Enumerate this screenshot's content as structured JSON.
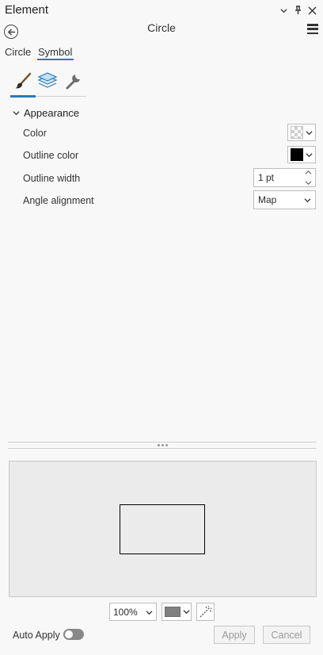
{
  "pane": {
    "title": "Element",
    "controls": [
      "options-dropdown",
      "pin-icon",
      "close-icon"
    ]
  },
  "header": {
    "title": "Circle"
  },
  "tabs": [
    {
      "label": "Circle",
      "active": false
    },
    {
      "label": "Symbol",
      "active": true
    }
  ],
  "icon_tabs": [
    {
      "icon": "paintbrush-icon",
      "active": true
    },
    {
      "icon": "layers-icon",
      "active": false
    },
    {
      "icon": "wrench-icon",
      "active": false
    }
  ],
  "appearance": {
    "section_label": "Appearance",
    "color_label": "Color",
    "color_value": "transparent",
    "outline_color_label": "Outline color",
    "outline_color_value": "#000000",
    "outline_width_label": "Outline width",
    "outline_width_value": "1 pt",
    "angle_alignment_label": "Angle alignment",
    "angle_alignment_value": "Map"
  },
  "preview_toolbar": {
    "zoom_value": "100%",
    "background_color": "#808080"
  },
  "footer": {
    "auto_apply_label": "Auto Apply",
    "auto_apply_on": false,
    "apply_label": "Apply",
    "cancel_label": "Cancel"
  },
  "colors": {
    "accent": "#2a7ab6"
  }
}
